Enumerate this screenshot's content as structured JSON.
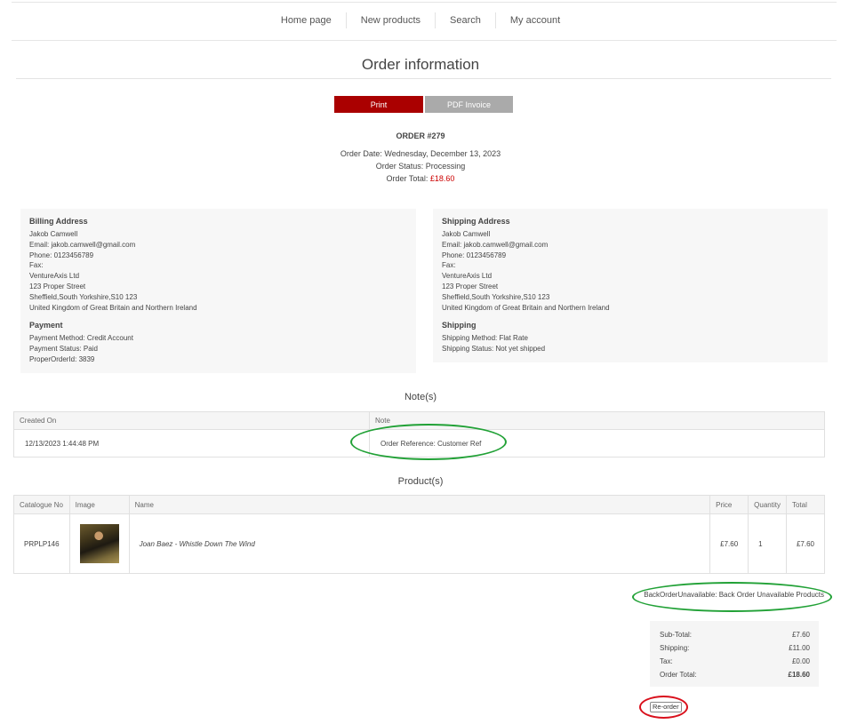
{
  "nav": {
    "items": [
      {
        "label": "Home page"
      },
      {
        "label": "New products"
      },
      {
        "label": "Search"
      },
      {
        "label": "My account"
      }
    ]
  },
  "page": {
    "title": "Order information"
  },
  "buttons": {
    "print": "Print",
    "pdf_invoice": "PDF Invoice",
    "reorder": "Re-order"
  },
  "order": {
    "number": "ORDER #279",
    "date": "Order Date: Wednesday, December 13, 2023",
    "status": "Order Status: Processing",
    "total_label": "Order Total: ",
    "total_value": "£18.60"
  },
  "billing": {
    "title": "Billing Address",
    "lines": [
      "Jakob Camwell",
      "Email: jakob.camwell@gmail.com",
      "Phone: 0123456789",
      "Fax:",
      "VentureAxis Ltd",
      "123 Proper Street",
      "Sheffield,South Yorkshire,S10 123",
      "United Kingdom of Great Britain and Northern Ireland"
    ]
  },
  "payment": {
    "title": "Payment",
    "lines": [
      "Payment Method: Credit Account",
      "Payment Status: Paid",
      "ProperOrderId: 3839"
    ]
  },
  "shipping_address": {
    "title": "Shipping Address",
    "lines": [
      "Jakob Camwell",
      "Email: jakob.camwell@gmail.com",
      "Phone: 0123456789",
      "Fax:",
      "VentureAxis Ltd",
      "123 Proper Street",
      "Sheffield,South Yorkshire,S10 123",
      "United Kingdom of Great Britain and Northern Ireland"
    ]
  },
  "shipping": {
    "title": "Shipping",
    "lines": [
      "Shipping Method: Flat Rate",
      "Shipping Status: Not yet shipped"
    ]
  },
  "notes": {
    "heading": "Note(s)",
    "columns": [
      "Created On",
      "Note"
    ],
    "rows": [
      {
        "created_on": "12/13/2023 1:44:48 PM",
        "note": "Order Reference: Customer Ref"
      }
    ]
  },
  "products": {
    "heading": "Product(s)",
    "columns": [
      "Catalogue No",
      "Image",
      "Name",
      "Price",
      "Quantity",
      "Total"
    ],
    "rows": [
      {
        "catalogue_no": "PRPLP146",
        "name": "Joan Baez - Whistle Down The Wind",
        "price": "£7.60",
        "quantity": "1",
        "total": "£7.60"
      }
    ]
  },
  "backorder": "BackOrderUnavailable: Back Order Unavailable Products",
  "totals": {
    "rows": [
      {
        "label": "Sub-Total:",
        "value": "£7.60"
      },
      {
        "label": "Shipping:",
        "value": "£11.00"
      },
      {
        "label": "Tax:",
        "value": "£0.00"
      },
      {
        "label": "Order Total:",
        "value": "£18.60"
      }
    ]
  },
  "colors": {
    "accent": "#aa0000",
    "annotation_green": "#21a136",
    "annotation_red": "#d9101c"
  }
}
